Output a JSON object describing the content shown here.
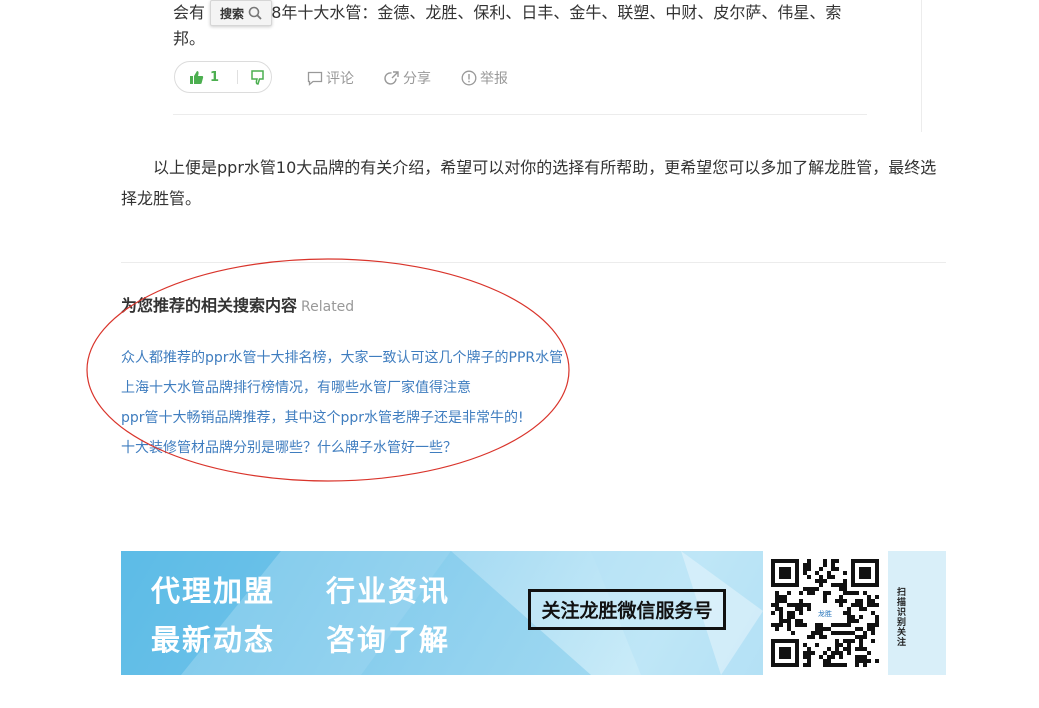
{
  "answer": {
    "text_prefix": "会有",
    "text_rest": "18年十大水管：金德、龙胜、保利、日丰、金牛、联塑、中财、皮尔萨、伟星、索",
    "text_line2": "邦。",
    "search_popup_label": "搜索",
    "like_count": "1",
    "actions": {
      "comment": "评论",
      "share": "分享",
      "report": "举报"
    }
  },
  "summary": "以上便是ppr水管10大品牌的有关介绍，希望可以对你的选择有所帮助，更希望您可以多加了解龙胜管，最终选择龙胜管。",
  "related": {
    "title": "为您推荐的相关搜索内容",
    "subtitle": "Related",
    "links": [
      "众人都推荐的ppr水管十大排名榜，大家一致认可这几个牌子的PPR水管",
      "上海十大水管品牌排行榜情况，有哪些水管厂家值得注意",
      "ppr管十大畅销品牌推荐，其中这个ppr水管老牌子还是非常牛的!",
      "十大装修管材品牌分别是哪些？什么牌子水管好一些？"
    ]
  },
  "banner": {
    "item1": "代理加盟",
    "item2": "行业资讯",
    "item3": "最新动态",
    "item4": "咨询了解",
    "wechat": "关注龙胜微信服务号",
    "qr_logo": "龙胜",
    "side": "扫描识别关注"
  },
  "colors": {
    "link": "#3f7dbf",
    "like": "#4caf50",
    "annotation": "#d9342b",
    "banner": "#6ec4ea"
  }
}
